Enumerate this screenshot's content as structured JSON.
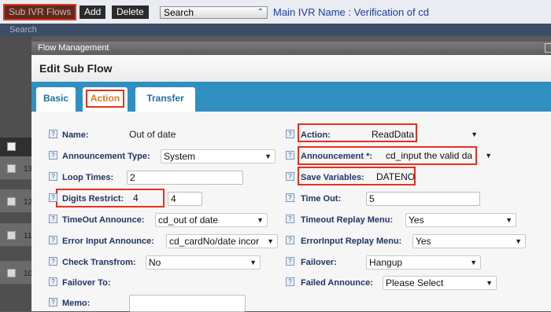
{
  "toolbar": {
    "sub_ivr_flows": "Sub IVR Flows",
    "add": "Add",
    "delete": "Delete",
    "search_select": "Search",
    "main_ivr_name": "Main IVR Name : Verification of cd"
  },
  "search_bar": {
    "label": "Search"
  },
  "background_rows": [
    "13",
    "12",
    "11",
    "10"
  ],
  "dialog": {
    "title": "Flow Management",
    "heading": "Edit Sub Flow",
    "tabs": {
      "basic": "Basic",
      "action": "Action",
      "transfer": "Transfer"
    }
  },
  "form": {
    "help_glyph": "?",
    "name_label": "Name:",
    "name_value": "Out of date",
    "announcement_type_label": "Announcement Type:",
    "announcement_type_value": "System",
    "loop_times_label": "Loop Times:",
    "loop_times_value": "2",
    "digits_restrict_label": "Digits Restrict:",
    "digits_restrict_min": "4",
    "digits_restrict_max": "4",
    "timeout_announce_label": "TimeOut Announce:",
    "timeout_announce_value": "cd_out of date",
    "error_input_announce_label": "Error Input Announce:",
    "error_input_announce_value": "cd_cardNo/date incor",
    "check_transfrom_label": "Check Transfrom:",
    "check_transfrom_value": "No",
    "failover_to_label": "Failover To:",
    "memo_label": "Memo:",
    "action_label": "Action:",
    "action_value": "ReadData",
    "announcement_label": "Announcement *:",
    "announcement_value": "cd_input the valid da",
    "save_variables_label": "Save Variables:",
    "save_variables_value": "DATENO",
    "time_out_label": "Time Out:",
    "time_out_value": "5",
    "timeout_replay_menu_label": "Timeout Replay Menu:",
    "timeout_replay_menu_value": "Yes",
    "errorinput_replay_menu_label": "ErrorInput Replay Menu:",
    "errorinput_replay_menu_value": "Yes",
    "failover_label": "Failover:",
    "failover_value": "Hangup",
    "failed_announce_label": "Failed Announce:",
    "failed_announce_value": "Please Select"
  },
  "colors": {
    "highlight": "#e8301c",
    "tab_strip": "#2f8fc0",
    "label": "#1f3562"
  }
}
